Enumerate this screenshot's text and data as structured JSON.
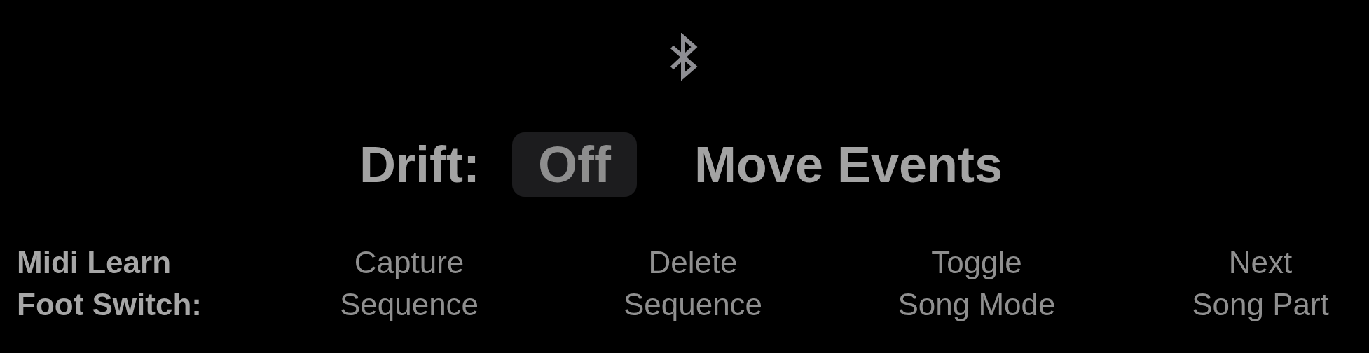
{
  "drift": {
    "label": "Drift:",
    "value": "Off"
  },
  "move_events": {
    "label": "Move Events"
  },
  "midi_learn": {
    "label": "Midi Learn\nFoot Switch:",
    "actions": [
      {
        "label": "Capture\nSequence"
      },
      {
        "label": "Delete\nSequence"
      },
      {
        "label": "Toggle\nSong Mode"
      },
      {
        "label": "Next\nSong Part"
      }
    ]
  }
}
